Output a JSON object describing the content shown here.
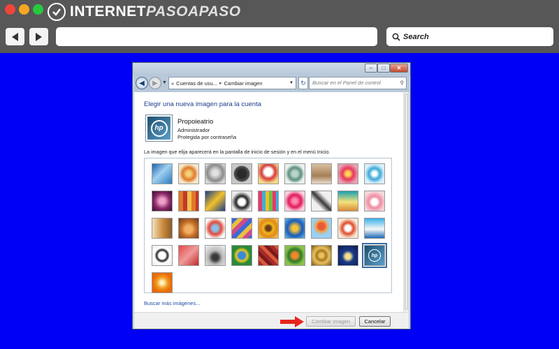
{
  "browser": {
    "logo_text_main": "INTERNET",
    "logo_text_accent": "PASOAPASO",
    "search_label": "Search"
  },
  "dialog": {
    "breadcrumb": [
      "Cuentas de usu...",
      "Cambiar imagen"
    ],
    "breadcrumb_prefix": "«",
    "search_placeholder": "Buscar en el Panel de control",
    "heading": "Elegir una nueva imagen para la cuenta",
    "user": {
      "name": "Propoieatrio",
      "role": "Administrador",
      "protection": "Protegida por contraseña",
      "avatar_mark": "hp"
    },
    "info_text": "La imagen que elija aparecerá en la pantalla de inicio de sesión y en el menú Inicio.",
    "more_link": "Buscar más imágenes...",
    "buttons": {
      "change": "Cambiar imagen",
      "cancel": "Cancelar"
    },
    "selected_tile": "hp"
  },
  "colors": {
    "desktop_bg": "#0000f5",
    "arrow": "#e8261c",
    "heading": "#1e3c8c"
  }
}
